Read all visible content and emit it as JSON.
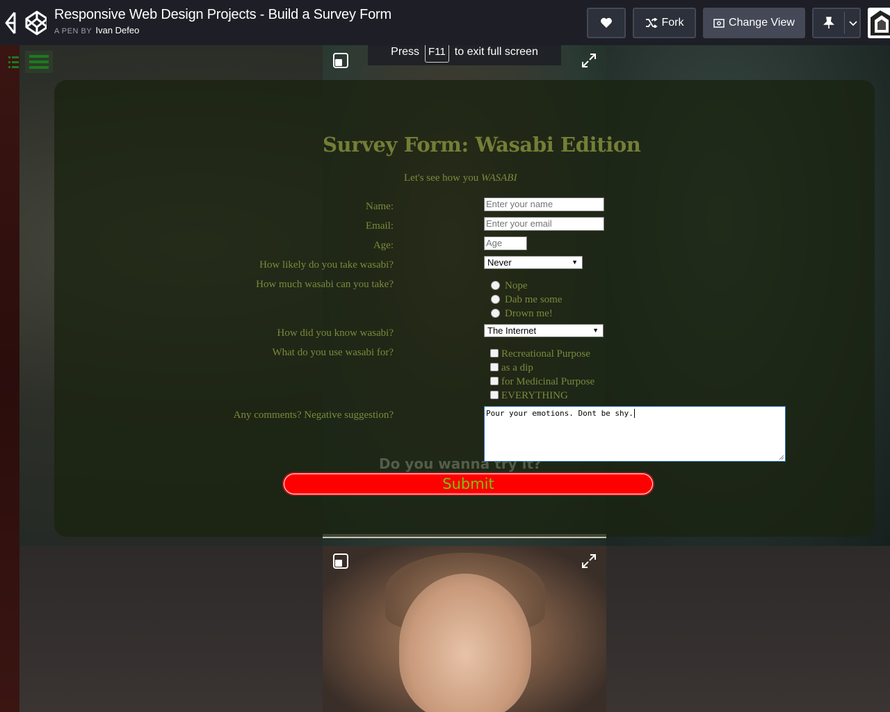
{
  "header": {
    "title": "Responsive Web Design Projects - Build a Survey Form",
    "by_label": "A PEN BY",
    "author": "Ivan Defeo",
    "fork_label": "Fork",
    "change_view_label": "Change View"
  },
  "toast": {
    "prefix": "Press",
    "key": "F11",
    "suffix": "to exit full screen"
  },
  "form": {
    "title": "Survey Form: Wasabi Edition",
    "subtitle_prefix": "Let's see how you",
    "subtitle_em": "WASABI",
    "name_label": "Name:",
    "name_placeholder": "Enter your name",
    "email_label": "Email:",
    "email_placeholder": "Enter your email",
    "age_label": "Age:",
    "age_placeholder": "Age",
    "likely_label": "How likely do you take wasabi?",
    "likely_value": "Never",
    "much_label": "How much wasabi can you take?",
    "radio_options": [
      "Nope",
      "Dab me some",
      "Drown me!"
    ],
    "know_label": "How did you know wasabi?",
    "know_value": "The Internet",
    "use_label": "What do you use wasabi for?",
    "check_options": [
      "Recreational Purpose",
      "as a dip",
      "for Medicinal Purpose",
      "EVERYTHING"
    ],
    "comments_label": "Any comments? Negative suggestion?",
    "comments_value": "Pour your emotions. Dont be shy.",
    "submit_label": "Submit"
  },
  "video_caption": "Do you wanna try it?",
  "colors": {
    "label_text": "#7a8a3c",
    "title_text": "#747e36",
    "submit_bg": "#ff0000",
    "submit_text": "#74c414"
  }
}
